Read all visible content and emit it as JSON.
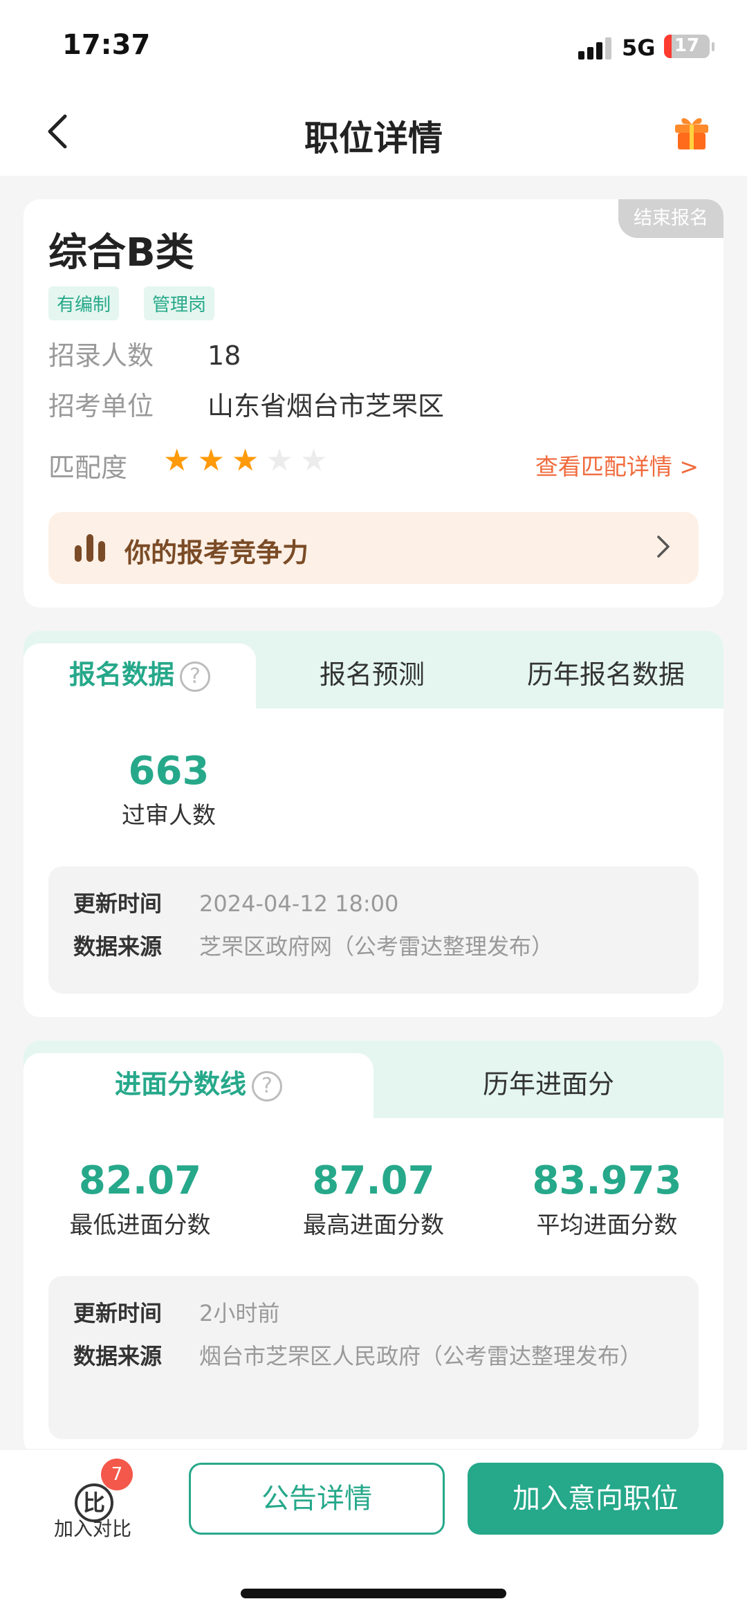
{
  "status_bar": {
    "time": "17:37",
    "network": "5G",
    "battery": "17",
    "battery_level": 0.17
  },
  "nav": {
    "title": "职位详情"
  },
  "position": {
    "name": "综合B类",
    "badge": "结束报名",
    "tags": [
      "有编制",
      "管理岗"
    ],
    "recruit_count_label": "招录人数",
    "recruit_count": "18",
    "unit_label": "招考单位",
    "unit": "山东省烟台市芝罘区",
    "match_label": "匹配度",
    "match_stars": 3,
    "match_stars_total": 5,
    "match_link": "查看匹配详情 >",
    "competitiveness": "你的报考竞争力"
  },
  "registration": {
    "tabs": [
      "报名数据",
      "报名预测",
      "历年报名数据"
    ],
    "help": "?",
    "passed_count": "663",
    "passed_label": "过审人数",
    "update_label": "更新时间",
    "update_value": "2024-04-12 18:00",
    "source_label": "数据来源",
    "source_value": "芝罘区政府网（公考雷达整理发布）"
  },
  "scoreline": {
    "tabs": [
      "进面分数线",
      "历年进面分"
    ],
    "help": "?",
    "min_score": "82.07",
    "min_label": "最低进面分数",
    "max_score": "87.07",
    "max_label": "最高进面分数",
    "avg_score": "83.973",
    "avg_label": "平均进面分数",
    "update_label": "更新时间",
    "update_value": "2小时前",
    "source_label": "数据来源",
    "source_value": "烟台市芝罘区人民政府（公考雷达整理发布）"
  },
  "bottom": {
    "compare_icon": "比",
    "compare_badge": "7",
    "compare_label": "加入对比",
    "notice_button": "公告详情",
    "add_button": "加入意向职位"
  }
}
